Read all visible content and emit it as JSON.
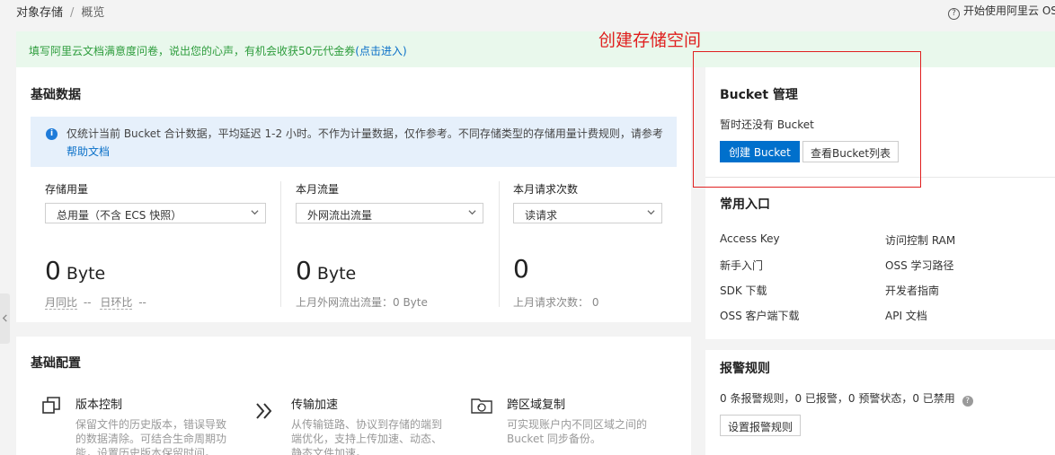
{
  "breadcrumb": {
    "root": "对象存储",
    "separator": "/",
    "current": "概览"
  },
  "help_link": {
    "label": "开始使用阿里云 OSS"
  },
  "notice": {
    "text": "填写阿里云文档满意度问卷，说出您的心声，有机会收获50元代金券",
    "link_label": "(点击进入)"
  },
  "annotation": {
    "label": "创建存储空间",
    "color": "#e02020"
  },
  "basic_data": {
    "title": "基础数据",
    "info_text": "仅统计当前 Bucket 合计数据，平均延迟 1-2 小时。不作为计量数据，仅作参考。不同存储类型的存储用量计费规则，请参考",
    "info_link": "帮助文档",
    "metrics": [
      {
        "label": "存储用量",
        "select": "总用量（不含 ECS 快照）",
        "value": "0",
        "unit": "Byte",
        "sub_a_label": "月同比",
        "sub_a_value": "--",
        "sub_b_label": "日环比",
        "sub_b_value": "--"
      },
      {
        "label": "本月流量",
        "select": "外网流出流量",
        "value": "0",
        "unit": "Byte",
        "sub": "上月外网流出流量：0 Byte"
      },
      {
        "label": "本月请求次数",
        "select": "读请求",
        "value": "0",
        "unit": "",
        "sub": "上月请求次数：  0"
      }
    ]
  },
  "basic_config": {
    "title": "基础配置",
    "features": [
      {
        "title": "版本控制",
        "desc": [
          "保留文件的历史版本，错误导致",
          "的数据清除。可结合生命周期功",
          "能，设置历史版本保留时间。"
        ],
        "icon": "copy-icon"
      },
      {
        "title": "传输加速",
        "desc": [
          "从传输链路、协议到存储的端到",
          "端优化，支持上传加速、动态、",
          "静态文件加速。"
        ],
        "icon": "double-chevron-right-icon"
      },
      {
        "title": "跨区域复制",
        "desc": [
          "可实现账户内不同区域之间的",
          "Bucket 同步备份。"
        ],
        "icon": "cross-region-icon"
      }
    ]
  },
  "bucket_mgmt": {
    "title": "Bucket 管理",
    "empty_hint": "暂时还没有 Bucket",
    "create_button": "创建 Bucket",
    "list_button": "查看Bucket列表"
  },
  "quick_links": {
    "title": "常用入口",
    "items": [
      "Access Key",
      "访问控制 RAM",
      "新手入门",
      "OSS 学习路径",
      "SDK 下载",
      "开发者指南",
      "OSS 客户端下载",
      "API 文档"
    ]
  },
  "alarm_rules": {
    "title": "报警规则",
    "summary": "0 条报警规则，0 已报警，0 预警状态，0 已禁用",
    "button": "设置报警规则"
  },
  "colors": {
    "primary": "#0070cc",
    "link": "#0a70c8",
    "notice_text": "#2d9c3c",
    "notice_bg": "#e9f8ec",
    "info_bg": "#e6f0fb"
  }
}
